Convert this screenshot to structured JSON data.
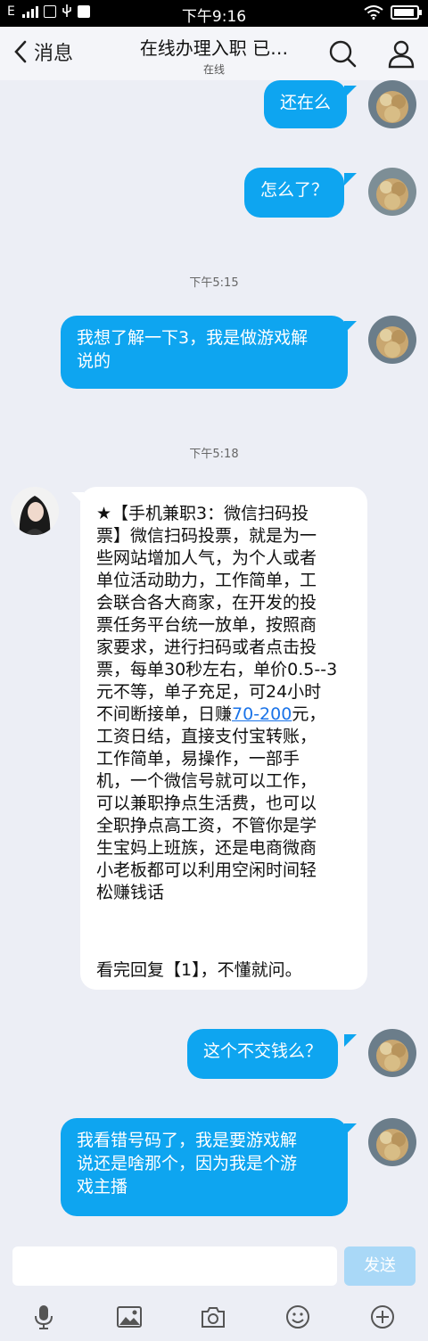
{
  "status_bar": {
    "network": "E",
    "time": "下午9:16"
  },
  "header": {
    "back_label": "消息",
    "title": "在线办理入职 已…",
    "subtitle": "在线"
  },
  "messages": {
    "m1": "还在么",
    "m2": "怎么了？",
    "ts1": "下午5:15",
    "m3_l1": "我想了解一下3，我是做游戏解",
    "m3_l2": "说的",
    "ts2": "下午5:18",
    "in_lines": [
      "★【手机兼职3：微信扫码投",
      "票】微信扫码投票，就是为一",
      "些网站增加人气，为个人或者",
      "单位活动助力，工作简单，工",
      "会联合各大商家，在开发的投",
      "票任务平台统一放单，按照商",
      "家要求，进行扫码或者点击投",
      "票，每单30秒左右，单价0.5--3",
      "元不等，单子充足，可24小时"
    ],
    "in_l10_a": "不间断接单，日赚",
    "in_l10_link": "70-200",
    "in_l10_b": "元，",
    "in_lines_b": [
      "工资日结，直接支付宝转账，",
      "工作简单，易操作，一部手",
      "机，一个微信号就可以工作，",
      "可以兼职挣点生活费，也可以",
      "全职挣点高工资，不管你是学",
      "生宝妈上班族，还是电商微商",
      "小老板都可以利用空闲时间轻",
      "松赚钱话"
    ],
    "in_footer": "看完回复【1】，不懂就问。",
    "m4": "这个不交钱么？",
    "m5_l1": "我看错号码了，我是要游戏解",
    "m5_l2": "说还是啥那个，因为我是个游",
    "m5_l3": "戏主播"
  },
  "input": {
    "value": "",
    "send_label": "发送"
  },
  "colors": {
    "bubble_out": "#0ea5f0",
    "background": "#eceef5"
  }
}
